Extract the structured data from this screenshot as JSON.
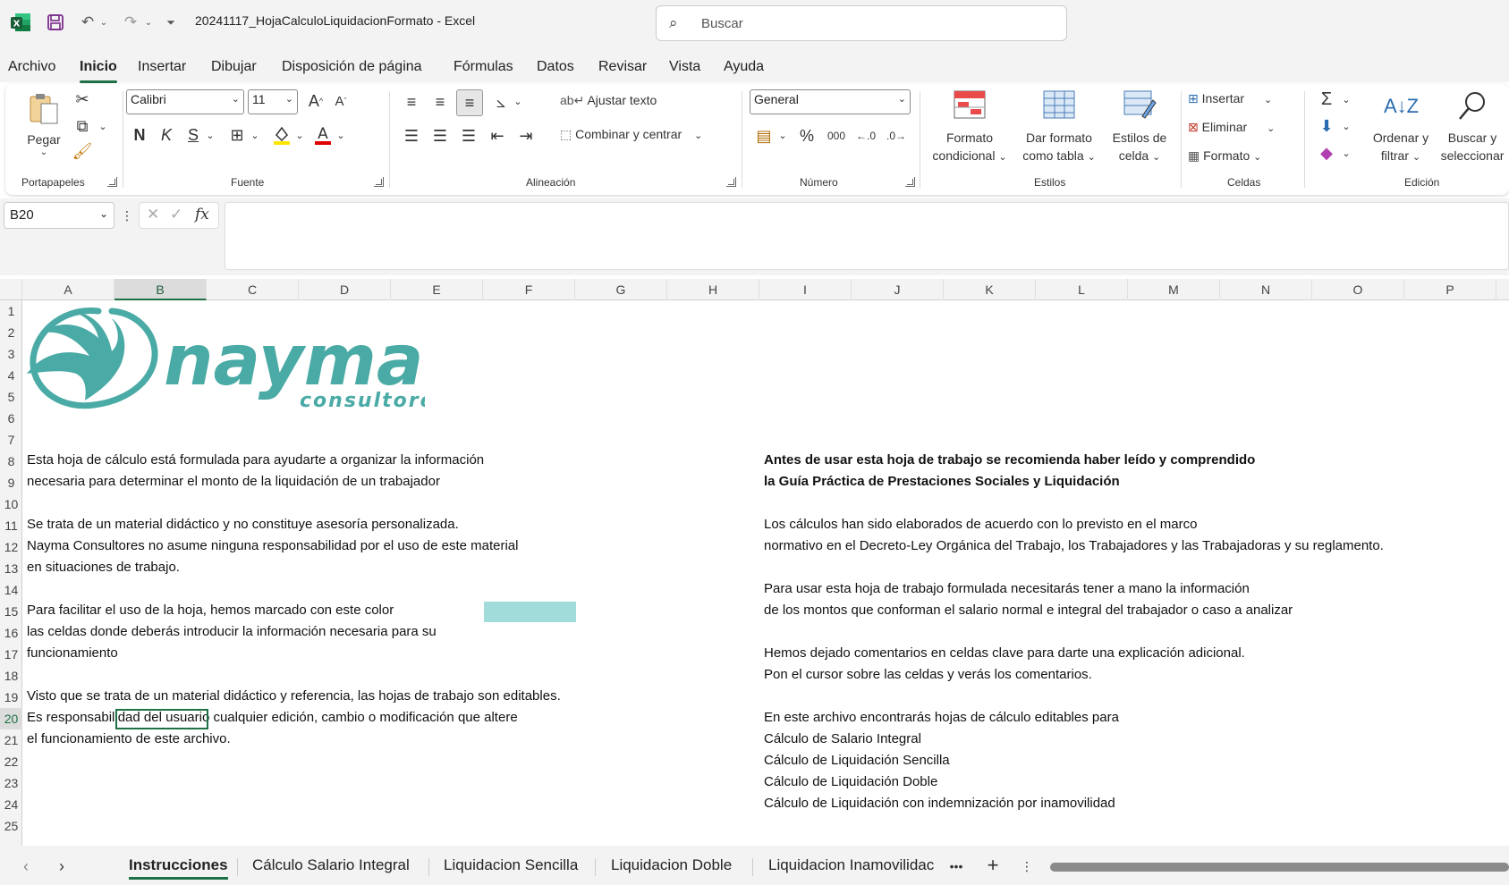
{
  "titlebar": {
    "doc_title": "20241117_HojaCalculoLiquidacionFormato  -  Excel",
    "search_placeholder": "Buscar"
  },
  "menu": [
    "Archivo",
    "Inicio",
    "Insertar",
    "Dibujar",
    "Disposición de página",
    "Fórmulas",
    "Datos",
    "Revisar",
    "Vista",
    "Ayuda"
  ],
  "menu_active": "Inicio",
  "ribbon": {
    "portapapeles": {
      "label": "Portapapeles",
      "paste": "Pegar"
    },
    "fuente": {
      "label": "Fuente",
      "font_name": "Calibri",
      "font_size": "11"
    },
    "alineacion": {
      "label": "Alineación",
      "wrap": "Ajustar texto",
      "merge": "Combinar y centrar"
    },
    "numero": {
      "label": "Número",
      "format": "General"
    },
    "estilos": {
      "label": "Estilos",
      "cond1": "Formato",
      "cond2": "condicional",
      "table1": "Dar formato",
      "table2": "como tabla",
      "cell1": "Estilos de",
      "cell2": "celda"
    },
    "celdas": {
      "label": "Celdas",
      "insert": "Insertar",
      "delete": "Eliminar",
      "format": "Formato"
    },
    "edicion": {
      "label": "Edición",
      "sort1": "Ordenar y",
      "sort2": "filtrar",
      "find1": "Buscar y",
      "find2": "seleccionar"
    }
  },
  "formula_bar": {
    "name_box": "B20",
    "fx": "fx",
    "formula": ""
  },
  "columns": [
    "A",
    "B",
    "C",
    "D",
    "E",
    "F",
    "G",
    "H",
    "I",
    "J",
    "K",
    "L",
    "M",
    "N",
    "O",
    "P"
  ],
  "selected_column": "B",
  "rows": [
    "1",
    "2",
    "3",
    "4",
    "5",
    "6",
    "7",
    "8",
    "9",
    "10",
    "11",
    "12",
    "13",
    "14",
    "15",
    "16",
    "17",
    "18",
    "19",
    "20",
    "21",
    "22",
    "23",
    "24",
    "25"
  ],
  "selected_row": "20",
  "logo": {
    "name": "nayma",
    "subtitle": "consultores"
  },
  "left_text": {
    "r8": "Esta hoja de cálculo está formulada para ayudarte a organizar la información",
    "r9": "necesaria para determinar el monto de la liquidación de un trabajador",
    "r11": "Se trata de un material didáctico y no constituye asesoría personalizada.",
    "r12": "Nayma Consultores no asume ninguna responsabilidad por el uso de este material",
    "r13": "en situaciones de trabajo.",
    "r15": "Para facilitar el uso de la hoja, hemos marcado con este color",
    "r16": "las celdas donde deberás introducir la información necesaria para su",
    "r17": "funcionamiento",
    "r19": "Visto que se trata de un material didáctico y referencia, las hojas de trabajo son editables.",
    "r20": "Es responsabilidad del usuario cualquier edición, cambio o modificación que altere",
    "r21": "el funcionamiento de este archivo."
  },
  "right_text": {
    "r8": "Antes de usar esta hoja de trabajo se recomienda haber leído y comprendido",
    "r9": "la Guía Práctica de Prestaciones Sociales y Liquidación",
    "r11": "Los cálculos han sido elaborados de acuerdo con lo previsto en el marco",
    "r12": "normativo en el Decreto-Ley Orgánica del Trabajo, los Trabajadores y las Trabajadoras y su reglamento.",
    "r14": "Para usar esta hoja de trabajo formulada necesitarás tener a mano la información",
    "r15": "de los montos que conforman el salario normal e integral del trabajador o caso a analizar",
    "r17": "Hemos dejado comentarios en celdas clave para darte una explicación adicional.",
    "r18": "Pon el cursor sobre las celdas y verás los comentarios.",
    "r20": "En este archivo encontrarás hojas de cálculo editables para",
    "r21": "Cálculo de Salario Integral",
    "r22": "Cálculo de Liquidación Sencilla",
    "r23": "Cálculo de Liquidación Doble",
    "r24": "Cálculo de Liquidación con indemnización por inamovilidad"
  },
  "input_color": "#a2dcda",
  "accent_color": "#1e7145",
  "sheets": [
    "Instrucciones",
    "Cálculo Salario Integral",
    "Liquidacion Sencilla",
    "Liquidacion Doble",
    "Liquidacion Inamovilidac"
  ],
  "active_sheet": "Instrucciones"
}
